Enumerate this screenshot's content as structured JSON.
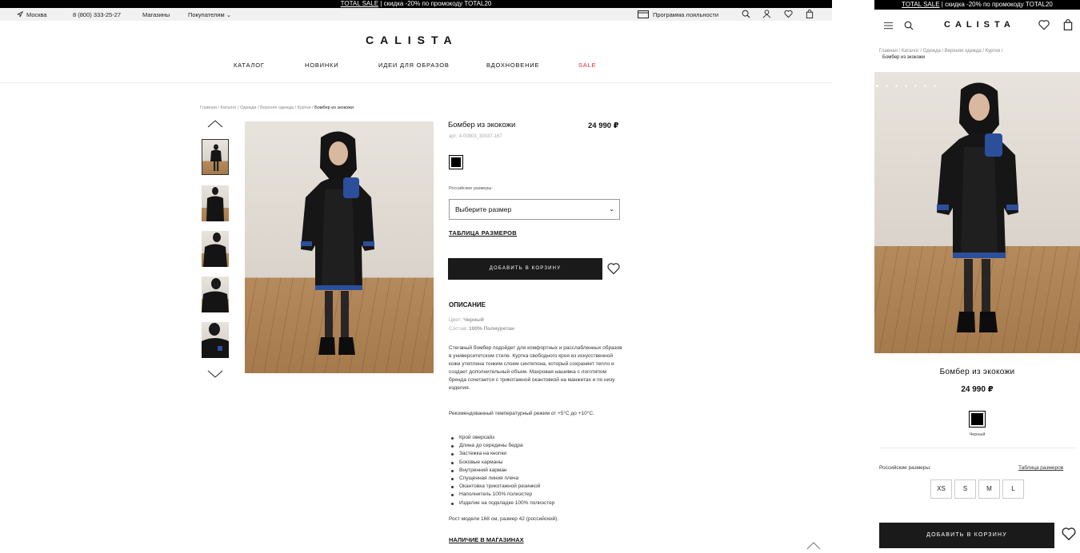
{
  "promo": {
    "link": "TOTAL SALE",
    "text": " | скидка -20% по промокоду TOTAL20"
  },
  "topbar": {
    "city": "Москва",
    "phone": "8 (800) 333-25-27",
    "stores": "Магазины",
    "customers": "Покупателям",
    "loyalty": "Программа лояльности"
  },
  "brand": "CALISTA",
  "nav": [
    "КАТАЛОГ",
    "НОВИНКИ",
    "ИДЕИ ДЛЯ ОБРАЗОВ",
    "ВДОХНОВЕНИЕ",
    "SALE"
  ],
  "breadcrumbs": {
    "items": [
      "Главная",
      "Каталог",
      "Одежда",
      "Верхняя одежда",
      "Куртки"
    ],
    "current": "Бомбер из экокожи",
    "sep": " / "
  },
  "product": {
    "name": "Бомбер из экокожи",
    "price": "24 990 ₽",
    "sku_label": "арт:",
    "sku": "4-00903_30037-167",
    "color_name": "Черный",
    "sizes_label": "Российские размеры:",
    "size_placeholder": "Выберите размер",
    "size_table": "ТАБЛИЦА РАЗМЕРОВ",
    "add_to_cart": "ДОБАВИТЬ В КОРЗИНУ",
    "description_title": "ОПИСАНИЕ",
    "color_label": "Цвет:",
    "composition_label": "Состав:",
    "composition": "100% Полиуретан",
    "description": "Стеганый бомбер подойдет для комфортных и расслабленных образов в университетском стиле. Куртка свободного кроя из искусственной кожи утеплена тонким слоем синтепона, который сохраняет тепло и создает дополнительный объем. Махровая нашивка с логотипом бренда сочетается с трикотажной окантовкой на манжетах и по низу изделия.",
    "temperature": "Рекомендованный температурный режим от +5°С до +10°С.",
    "features": [
      "Крой оверсайз",
      "Длина до середины бедра",
      "Застежка на кнопки",
      "Боковые карманы",
      "Внутренний карман",
      "Спущенная линия плеча",
      "Окантовка трикотажной резинкой",
      "Наполнитель 100% полиэстер",
      "Изделие на подкладке 100% полиэстер"
    ],
    "model_info": "Рост модели 168 см, размер 42 (российский).",
    "availability": "НАЛИЧИЕ В МАГАЗИНАХ"
  },
  "mobile": {
    "promo_link": "TOTAL SALE",
    "promo_text": " | скидка -20% по промокоду TOTAL20",
    "breadcrumbs_line1": "Главная / Каталог / Одежда / Верхняя одежда / Куртки /",
    "breadcrumbs_line2": "Бомбер из экокожи",
    "size_table": "Таблица размеров",
    "sizes": [
      "XS",
      "S",
      "M",
      "L"
    ]
  },
  "colors": {
    "accent_sale": "#e0262e",
    "swatch": "#000000"
  }
}
